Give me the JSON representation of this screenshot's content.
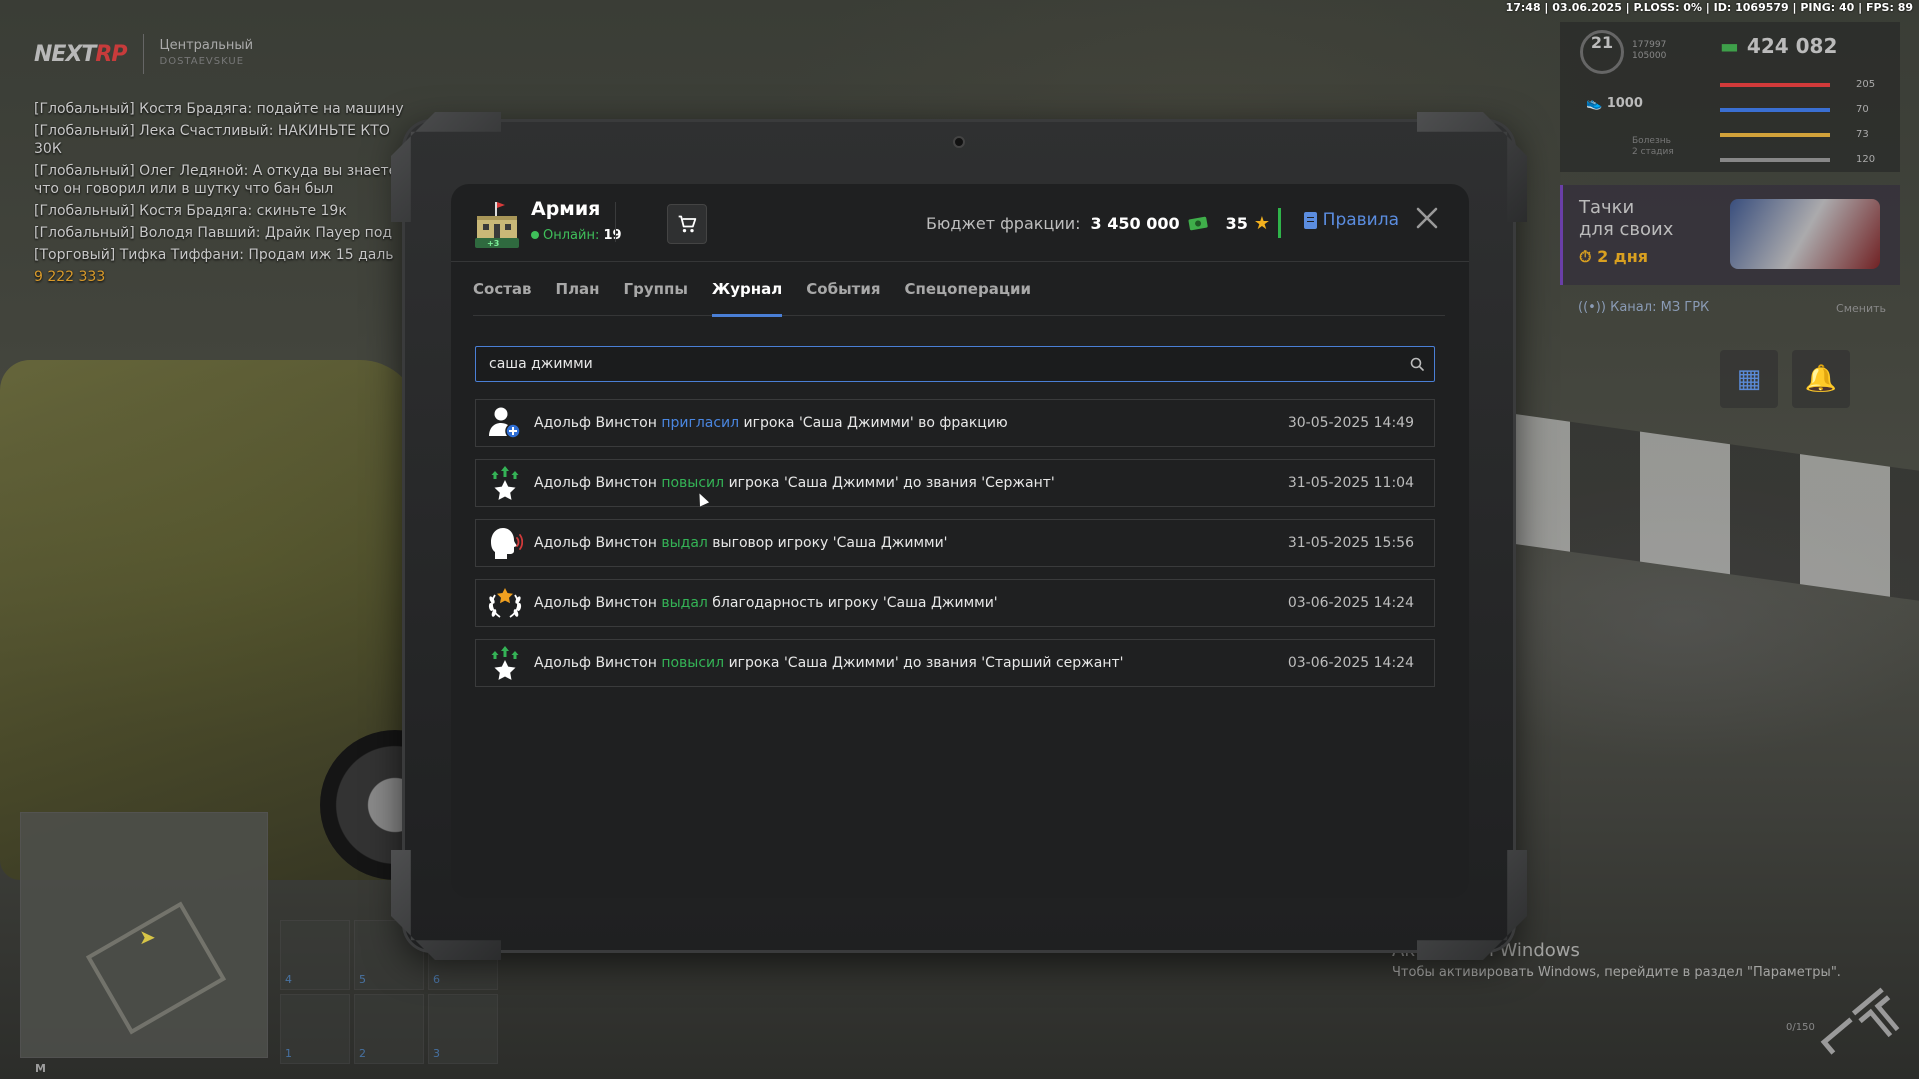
{
  "status_bar": "17:48 | 03.06.2025 | P.LOSS: 0% | ID: 1069579 | PING: 40 | FPS: 89",
  "logo": {
    "left": "NEXT",
    "right": "RP",
    "server": "Центральный",
    "district": "DOSTAEVSKUE"
  },
  "chat": [
    {
      "text": "[Глобальный] Костя Брадяга: подайте на машину",
      "style": "normal"
    },
    {
      "text": "[Глобальный] Лека Счастливый: НАКИНЬТЕ КТО 30К",
      "style": "wrap"
    },
    {
      "text": "[Глобальный] Олег Ледяной: А откуда вы знаете что он говорил или в шутку что бан был",
      "style": "wrap"
    },
    {
      "text": "[Глобальный] Костя Брадяга: скиньте 19к",
      "style": "normal"
    },
    {
      "text": "[Глобальный] Володя Павший: Драйк Пауер под",
      "style": "normal"
    },
    {
      "text": "[Торговый] Тифка Тиффани: Продам иж 15 даль",
      "style": "normal"
    },
    {
      "text": "9 222 333",
      "style": "warn"
    }
  ],
  "minimap": {
    "key_label": "M"
  },
  "hotbar": [
    "4",
    "5",
    "6",
    "1",
    "2",
    "3"
  ],
  "hud": {
    "level": "21",
    "xp_current": "177997",
    "xp_total": "105000",
    "money": "424 082",
    "speed": "1000",
    "sick_label": "Болезнь",
    "sick_stage": "2 стадия",
    "bars": [
      {
        "value": "205",
        "color": "#d23a3a"
      },
      {
        "value": "70",
        "color": "#3a6fd2"
      },
      {
        "value": "73",
        "color": "#d2a23a"
      },
      {
        "value": "120",
        "color": "#888888"
      }
    ]
  },
  "promo": {
    "line1": "Тачки",
    "line2": "для своих",
    "timer": "2 дня"
  },
  "channel": {
    "label": "Канал:",
    "name": "МЗ ГРК",
    "switch_label": "Сменить"
  },
  "windows": {
    "title": "Активация Windows",
    "subtitle": "Чтобы активировать Windows, перейдите в раздел \"Параметры\"."
  },
  "ammo": "0/150",
  "faction": {
    "name": "Армия",
    "online_label": "Онлайн:",
    "online_count": "19",
    "badge": "+3",
    "budget_label": "Бюджет фракции:",
    "budget_value": "3 450 000",
    "stars_value": "35",
    "rules_label": "Правила"
  },
  "tabs": [
    {
      "label": "Состав",
      "active": false
    },
    {
      "label": "План",
      "active": false
    },
    {
      "label": "Группы",
      "active": false
    },
    {
      "label": "Журнал",
      "active": true
    },
    {
      "label": "События",
      "active": false
    },
    {
      "label": "Спецоперации",
      "active": false
    }
  ],
  "search": {
    "value": "саша джимми",
    "placeholder": ""
  },
  "log": [
    {
      "icon": "user-add-icon",
      "actor": "Адольф Винстон",
      "action": "пригласил",
      "action_color": "blue",
      "rest": "игрока 'Саша Джимми' во фракцию",
      "date": "30-05-2025 14:49"
    },
    {
      "icon": "promote-icon",
      "actor": "Адольф Винстон",
      "action": "повысил",
      "action_color": "green",
      "rest": "игрока 'Саша Джимми' до звания 'Сержант'",
      "date": "31-05-2025 11:04"
    },
    {
      "icon": "reprimand-icon",
      "actor": "Адольф Винстон",
      "action": "выдал",
      "action_color": "green",
      "rest": "выговор игроку 'Саша Джимми'",
      "date": "31-05-2025 15:56"
    },
    {
      "icon": "laurel-icon",
      "actor": "Адольф Винстон",
      "action": "выдал",
      "action_color": "green",
      "rest": "благодарность игроку 'Саша Джимми'",
      "date": "03-06-2025 14:24"
    },
    {
      "icon": "promote-icon",
      "actor": "Адольф Винстон",
      "action": "повысил",
      "action_color": "green",
      "rest": "игрока 'Саша Джимми' до звания 'Старший сержант'",
      "date": "03-06-2025 14:24"
    }
  ]
}
